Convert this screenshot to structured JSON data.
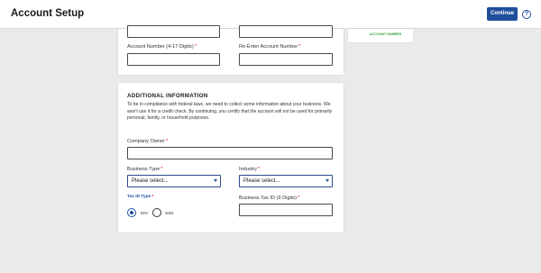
{
  "header": {
    "title": "Account Setup",
    "continue_label": "Continue",
    "help_glyph": "?"
  },
  "side_card": {
    "logo_text": "ACCOUNT NUMBER"
  },
  "account_fields": {
    "account_number_label": "Account Number (4-17 Digits)",
    "reenter_label": "Re-Enter Account Number",
    "required_mark": "*"
  },
  "additional_info": {
    "title": "ADDITIONAL INFORMATION",
    "description": "To be in compliance with federal laws, we need to collect some information about your business. We won't use it for a credit check. By continuing, you certify that the account will not be used for primarily personal, family, or household purposes.",
    "company_owner_label": "Company Owner",
    "business_type_label": "Business Type",
    "business_type_value": "Please select...",
    "industry_label": "Industry",
    "industry_value": "Please select...",
    "tax_id_type_label": "Tax ID Type",
    "tax_id_options": [
      {
        "label": "EIN",
        "selected": true
      },
      {
        "label": "SSN",
        "selected": false
      }
    ],
    "business_tax_id_label": "Business Tax ID (9 Digits)",
    "required_mark": "*"
  },
  "colors": {
    "accent": "#1f4e9c",
    "required": "#c8102e",
    "background": "#e9eaec"
  }
}
